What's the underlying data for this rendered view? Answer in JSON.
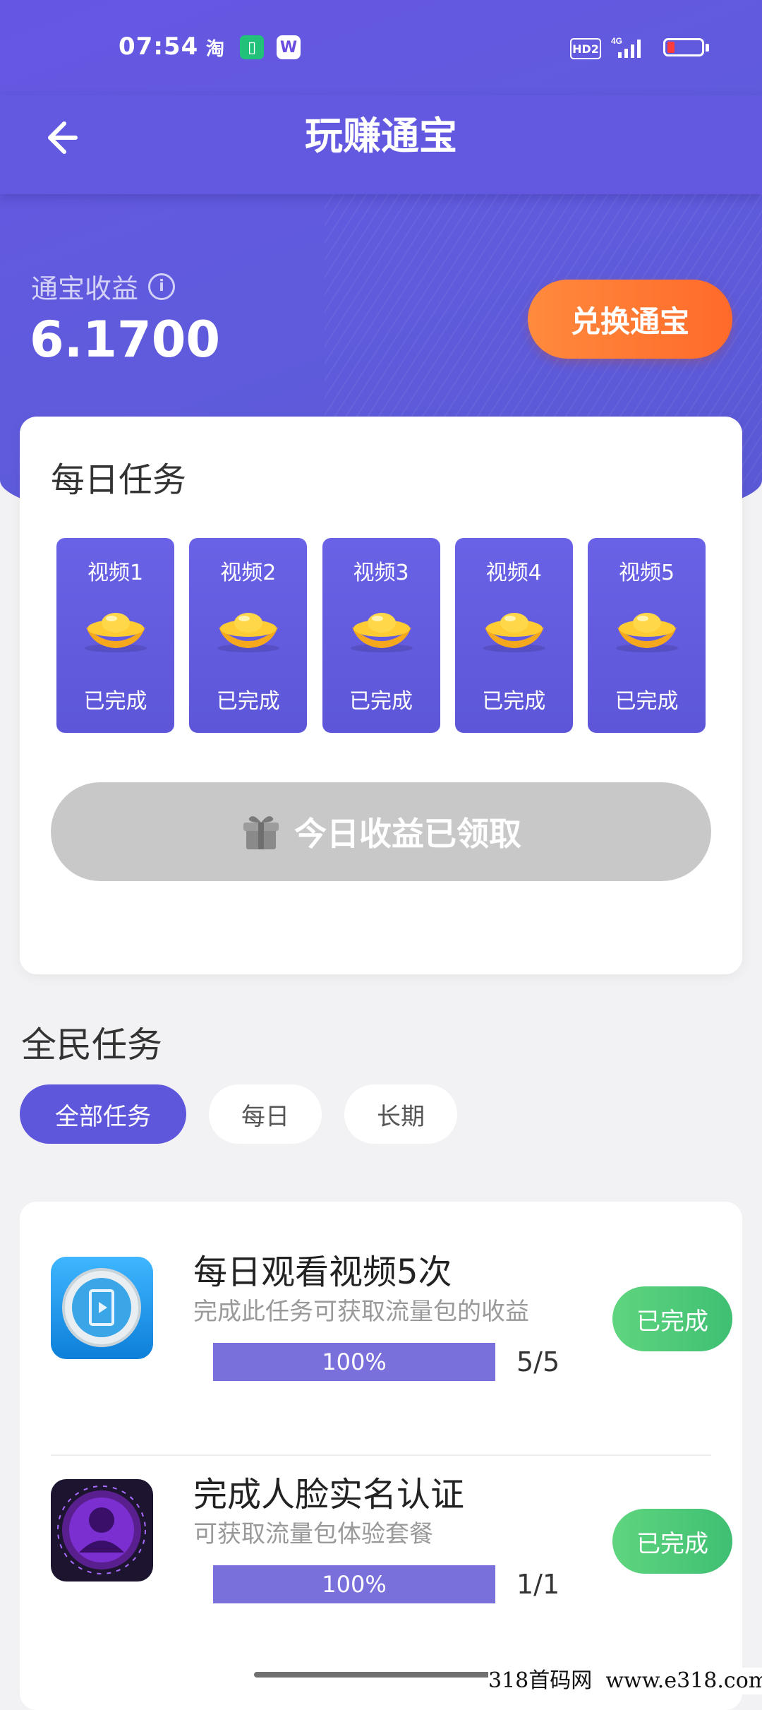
{
  "status_bar": {
    "time": "07:54",
    "app_icons": [
      "taobao-icon",
      "battery-saver-icon",
      "wps-icon"
    ],
    "hd_label": "HD2",
    "network_label": "4G"
  },
  "header": {
    "title": "玩赚通宝"
  },
  "earnings": {
    "label": "通宝收益",
    "value": "6.1700",
    "exchange_label": "兑换通宝"
  },
  "daily_tasks": {
    "title": "每日任务",
    "videos": [
      {
        "label": "视频1",
        "status": "已完成"
      },
      {
        "label": "视频2",
        "status": "已完成"
      },
      {
        "label": "视频3",
        "status": "已完成"
      },
      {
        "label": "视频4",
        "status": "已完成"
      },
      {
        "label": "视频5",
        "status": "已完成"
      }
    ],
    "claimed_label": "今日收益已领取"
  },
  "all_tasks": {
    "title": "全民任务",
    "filters": [
      "全部任务",
      "每日",
      "长期"
    ],
    "active_filter": "全部任务",
    "items": [
      {
        "title": "每日观看视频5次",
        "desc": "完成此任务可获取流量包的收益",
        "progress": "100%",
        "progress_value": 1.0,
        "count": "5/5",
        "button": "已完成"
      },
      {
        "title": "完成人脸实名认证",
        "desc": "可获取流量包体验套餐",
        "progress": "100%",
        "progress_value": 1.0,
        "count": "1/1",
        "button": "已完成"
      }
    ]
  },
  "watermark": "318首码网  www.e318.com",
  "colors": {
    "primary": "#6359e0",
    "accent_orange": "#ff7a34",
    "success_green": "#4cc977",
    "disabled_gray": "#c8c8c8"
  }
}
